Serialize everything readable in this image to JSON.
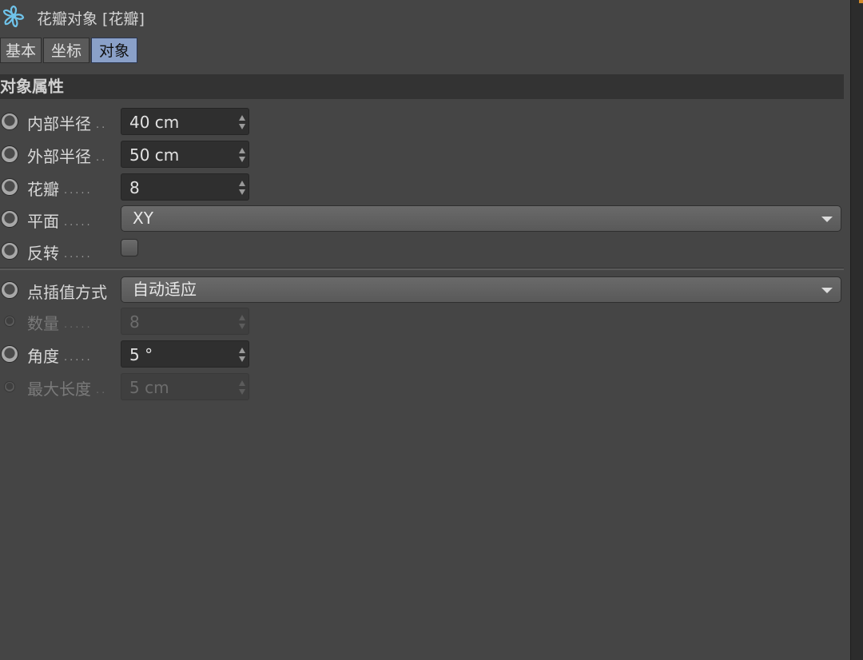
{
  "title": "花瓣对象 [花瓣]",
  "tabs": [
    {
      "label": "基本"
    },
    {
      "label": "坐标"
    },
    {
      "label": "对象"
    }
  ],
  "section_title": "对象属性",
  "params": {
    "inner_radius": {
      "label": "内部半径",
      "dots": "..",
      "value": "40 cm"
    },
    "outer_radius": {
      "label": "外部半径",
      "dots": "..",
      "value": "50 cm"
    },
    "petals": {
      "label": "花瓣",
      "dots": ".....",
      "value": "8"
    },
    "plane": {
      "label": "平面",
      "dots": ".....",
      "value": "XY"
    },
    "reverse": {
      "label": "反转",
      "dots": ".....",
      "checked": false
    },
    "interpolation": {
      "label": "点插值方式",
      "value": "自动适应"
    },
    "count": {
      "label": "数量",
      "dots": ".....",
      "value": "8",
      "enabled": false
    },
    "angle": {
      "label": "角度",
      "dots": ".....",
      "value": "5 °"
    },
    "max_length": {
      "label": "最大长度",
      "dots": "..",
      "value": "5 cm",
      "enabled": false
    }
  },
  "colors": {
    "background": "#454545",
    "active_tab": "#8aa0c8",
    "section_header": "#333333",
    "field": "#2f2f2f",
    "icon": "#6fc3ea"
  },
  "icons": {
    "title": "flower-icon"
  }
}
